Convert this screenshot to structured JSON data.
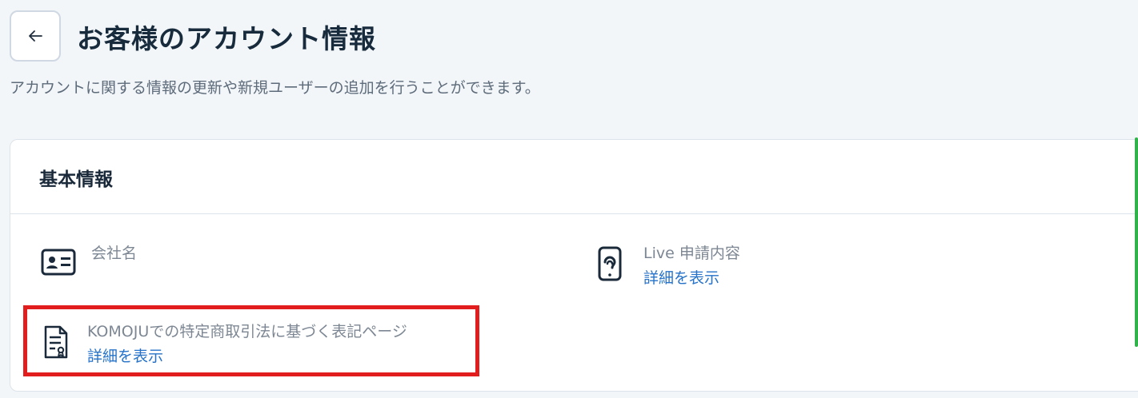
{
  "header": {
    "back_icon": "arrow-left-icon",
    "title": "お客様のアカウント情報",
    "subtitle": "アカウントに関する情報の更新や新規ユーザーの追加を行うことができます。"
  },
  "basic_info": {
    "title": "基本情報",
    "company": {
      "icon": "id-card-icon",
      "label": "会社名"
    },
    "live_application": {
      "icon": "device-support-icon",
      "label": "Live 申請内容",
      "link": "詳細を表示"
    },
    "commerce_law": {
      "icon": "document-certificate-icon",
      "label": "KOMOJUでの特定商取引法に基づく表記ページ",
      "link": "詳細を表示"
    }
  },
  "colors": {
    "background": "#f3f6f9",
    "title_text": "#172b3d",
    "link": "#2673c9",
    "highlight_box": "#e11d1d",
    "accent_green": "#32b24a"
  }
}
